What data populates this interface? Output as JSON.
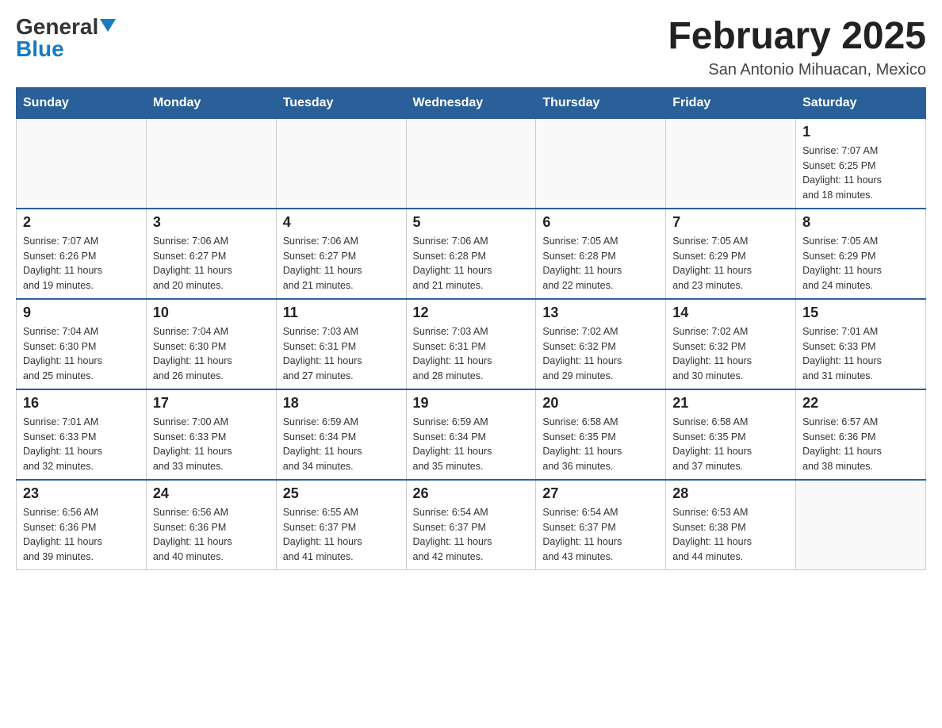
{
  "header": {
    "logo_general": "General",
    "logo_blue": "Blue",
    "month_title": "February 2025",
    "location": "San Antonio Mihuacan, Mexico"
  },
  "days_of_week": [
    "Sunday",
    "Monday",
    "Tuesday",
    "Wednesday",
    "Thursday",
    "Friday",
    "Saturday"
  ],
  "weeks": [
    [
      {
        "day": "",
        "info": ""
      },
      {
        "day": "",
        "info": ""
      },
      {
        "day": "",
        "info": ""
      },
      {
        "day": "",
        "info": ""
      },
      {
        "day": "",
        "info": ""
      },
      {
        "day": "",
        "info": ""
      },
      {
        "day": "1",
        "info": "Sunrise: 7:07 AM\nSunset: 6:25 PM\nDaylight: 11 hours\nand 18 minutes."
      }
    ],
    [
      {
        "day": "2",
        "info": "Sunrise: 7:07 AM\nSunset: 6:26 PM\nDaylight: 11 hours\nand 19 minutes."
      },
      {
        "day": "3",
        "info": "Sunrise: 7:06 AM\nSunset: 6:27 PM\nDaylight: 11 hours\nand 20 minutes."
      },
      {
        "day": "4",
        "info": "Sunrise: 7:06 AM\nSunset: 6:27 PM\nDaylight: 11 hours\nand 21 minutes."
      },
      {
        "day": "5",
        "info": "Sunrise: 7:06 AM\nSunset: 6:28 PM\nDaylight: 11 hours\nand 21 minutes."
      },
      {
        "day": "6",
        "info": "Sunrise: 7:05 AM\nSunset: 6:28 PM\nDaylight: 11 hours\nand 22 minutes."
      },
      {
        "day": "7",
        "info": "Sunrise: 7:05 AM\nSunset: 6:29 PM\nDaylight: 11 hours\nand 23 minutes."
      },
      {
        "day": "8",
        "info": "Sunrise: 7:05 AM\nSunset: 6:29 PM\nDaylight: 11 hours\nand 24 minutes."
      }
    ],
    [
      {
        "day": "9",
        "info": "Sunrise: 7:04 AM\nSunset: 6:30 PM\nDaylight: 11 hours\nand 25 minutes."
      },
      {
        "day": "10",
        "info": "Sunrise: 7:04 AM\nSunset: 6:30 PM\nDaylight: 11 hours\nand 26 minutes."
      },
      {
        "day": "11",
        "info": "Sunrise: 7:03 AM\nSunset: 6:31 PM\nDaylight: 11 hours\nand 27 minutes."
      },
      {
        "day": "12",
        "info": "Sunrise: 7:03 AM\nSunset: 6:31 PM\nDaylight: 11 hours\nand 28 minutes."
      },
      {
        "day": "13",
        "info": "Sunrise: 7:02 AM\nSunset: 6:32 PM\nDaylight: 11 hours\nand 29 minutes."
      },
      {
        "day": "14",
        "info": "Sunrise: 7:02 AM\nSunset: 6:32 PM\nDaylight: 11 hours\nand 30 minutes."
      },
      {
        "day": "15",
        "info": "Sunrise: 7:01 AM\nSunset: 6:33 PM\nDaylight: 11 hours\nand 31 minutes."
      }
    ],
    [
      {
        "day": "16",
        "info": "Sunrise: 7:01 AM\nSunset: 6:33 PM\nDaylight: 11 hours\nand 32 minutes."
      },
      {
        "day": "17",
        "info": "Sunrise: 7:00 AM\nSunset: 6:33 PM\nDaylight: 11 hours\nand 33 minutes."
      },
      {
        "day": "18",
        "info": "Sunrise: 6:59 AM\nSunset: 6:34 PM\nDaylight: 11 hours\nand 34 minutes."
      },
      {
        "day": "19",
        "info": "Sunrise: 6:59 AM\nSunset: 6:34 PM\nDaylight: 11 hours\nand 35 minutes."
      },
      {
        "day": "20",
        "info": "Sunrise: 6:58 AM\nSunset: 6:35 PM\nDaylight: 11 hours\nand 36 minutes."
      },
      {
        "day": "21",
        "info": "Sunrise: 6:58 AM\nSunset: 6:35 PM\nDaylight: 11 hours\nand 37 minutes."
      },
      {
        "day": "22",
        "info": "Sunrise: 6:57 AM\nSunset: 6:36 PM\nDaylight: 11 hours\nand 38 minutes."
      }
    ],
    [
      {
        "day": "23",
        "info": "Sunrise: 6:56 AM\nSunset: 6:36 PM\nDaylight: 11 hours\nand 39 minutes."
      },
      {
        "day": "24",
        "info": "Sunrise: 6:56 AM\nSunset: 6:36 PM\nDaylight: 11 hours\nand 40 minutes."
      },
      {
        "day": "25",
        "info": "Sunrise: 6:55 AM\nSunset: 6:37 PM\nDaylight: 11 hours\nand 41 minutes."
      },
      {
        "day": "26",
        "info": "Sunrise: 6:54 AM\nSunset: 6:37 PM\nDaylight: 11 hours\nand 42 minutes."
      },
      {
        "day": "27",
        "info": "Sunrise: 6:54 AM\nSunset: 6:37 PM\nDaylight: 11 hours\nand 43 minutes."
      },
      {
        "day": "28",
        "info": "Sunrise: 6:53 AM\nSunset: 6:38 PM\nDaylight: 11 hours\nand 44 minutes."
      },
      {
        "day": "",
        "info": ""
      }
    ]
  ]
}
